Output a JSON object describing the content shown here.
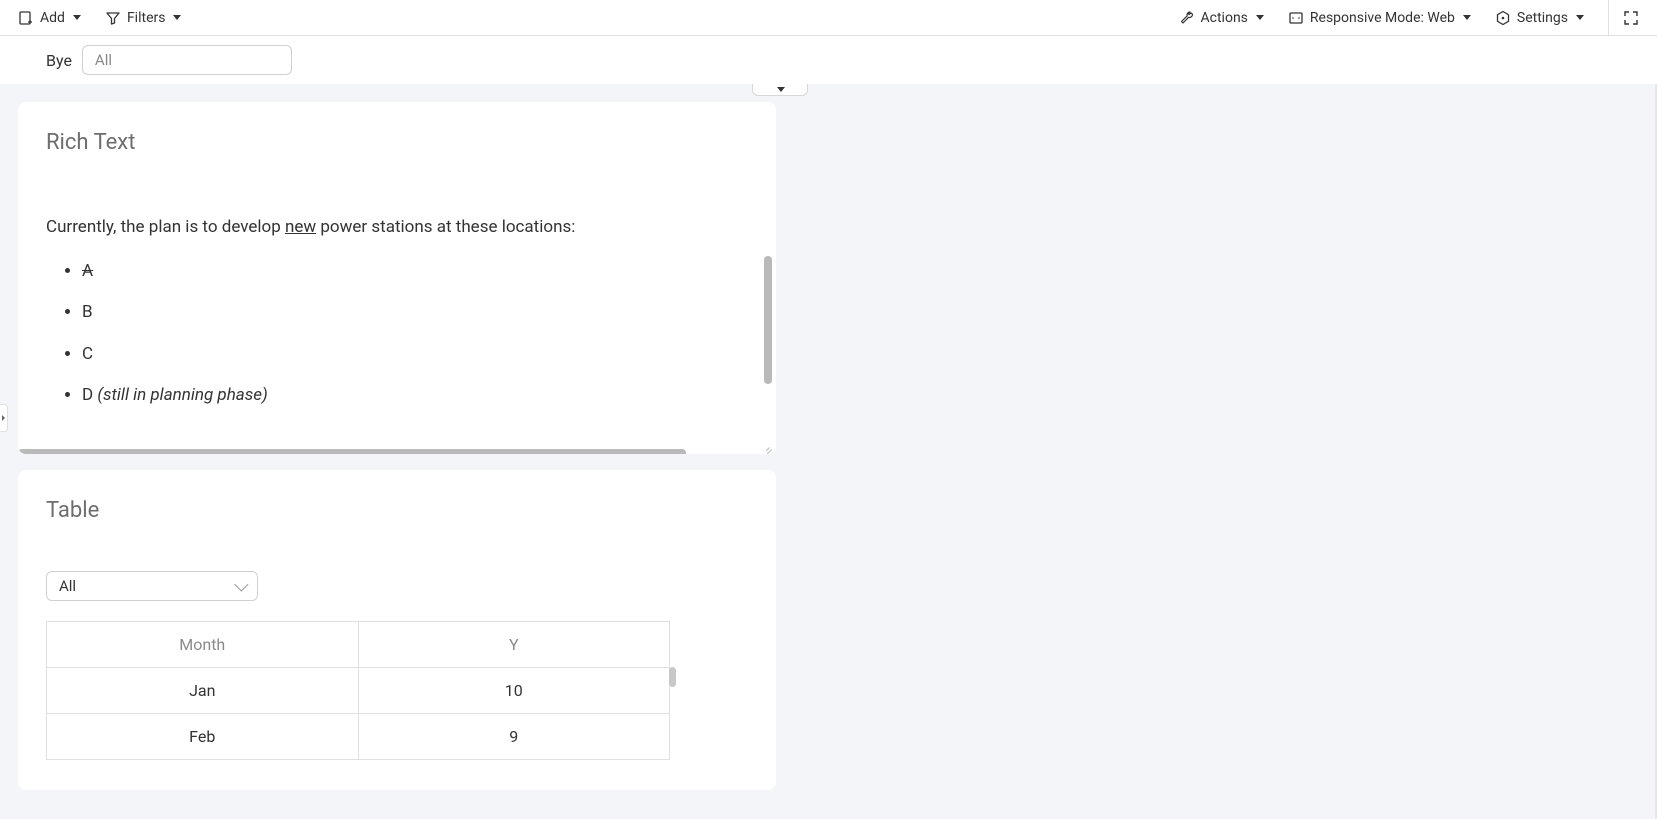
{
  "toolbar": {
    "add_label": "Add",
    "filters_label": "Filters",
    "actions_label": "Actions",
    "responsive_label": "Responsive Mode: Web",
    "settings_label": "Settings"
  },
  "filterbar": {
    "label": "Bye",
    "value": "All"
  },
  "richtext": {
    "title": "Rich Text",
    "paragraph_pre": "Currently, the plan is to develop ",
    "paragraph_underline": "new",
    "paragraph_post": " power stations at these locations:",
    "items": [
      {
        "text": "A",
        "strike": true,
        "note": ""
      },
      {
        "text": "B",
        "strike": false,
        "note": ""
      },
      {
        "text": "C",
        "strike": false,
        "note": ""
      },
      {
        "text": "D ",
        "strike": false,
        "note": "(still in planning phase)"
      }
    ]
  },
  "table": {
    "title": "Table",
    "select_value": "All",
    "headers": [
      "Month",
      "Y"
    ],
    "rows": [
      [
        "Jan",
        "10"
      ],
      [
        "Feb",
        "9"
      ]
    ]
  }
}
